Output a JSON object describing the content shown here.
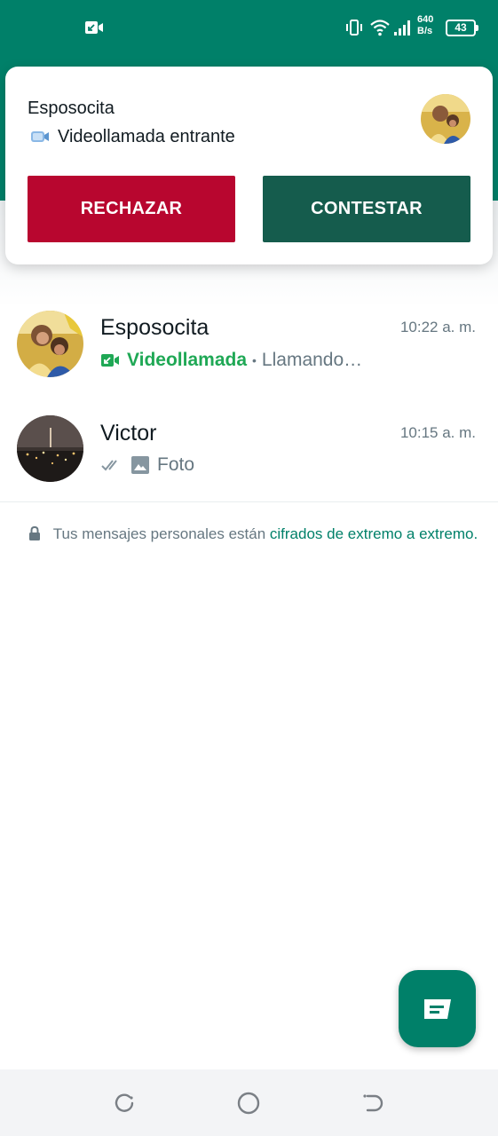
{
  "status_bar": {
    "speed_value": "640",
    "speed_unit": "B/s",
    "battery": "43",
    "icons": [
      "video-call-icon",
      "vibrate-icon",
      "wifi-icon",
      "signal-icon",
      "battery-icon"
    ]
  },
  "incoming_call": {
    "caller": "Esposocita",
    "subtitle": "Videollamada entrante",
    "reject_label": "RECHAZAR",
    "accept_label": "CONTESTAR",
    "colors": {
      "reject": "#b8062f",
      "accept": "#155c4d"
    }
  },
  "chats": [
    {
      "name": "Esposocita",
      "time": "10:22 a. m.",
      "preview_highlight": "Videollamada",
      "preview_separator": "•",
      "preview_text": "Llamando…",
      "preview_icon": "incoming-video-icon"
    },
    {
      "name": "Victor",
      "time": "10:15 a. m.",
      "preview_text": "Foto",
      "preview_icons": [
        "double-check-icon",
        "photo-icon"
      ]
    }
  ],
  "encryption_notice": {
    "text": "Tus mensajes personales están",
    "link": "cifrados de extremo a extremo",
    "suffix": "."
  },
  "fab": {
    "icon": "new-chat-icon"
  },
  "nav": {
    "icons": [
      "recents-icon",
      "home-icon",
      "back-icon"
    ]
  },
  "colors": {
    "brand": "#008069",
    "accent_green": "#1fa855",
    "secondary_text": "#667781"
  }
}
